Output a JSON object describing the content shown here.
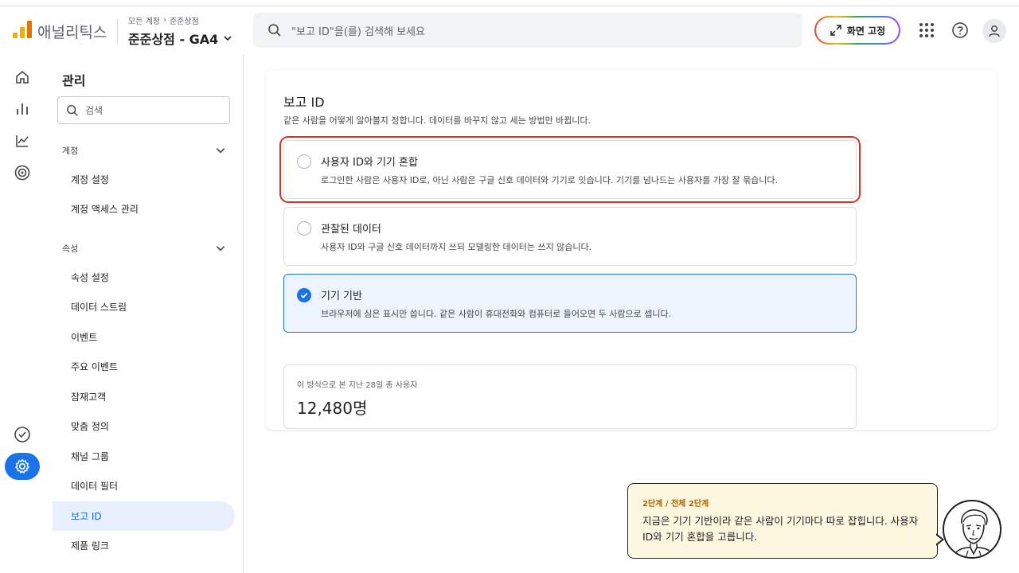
{
  "header": {
    "app_name": "애널리틱스",
    "breadcrumb_root": "모든 계정",
    "breadcrumb_sep": "›",
    "breadcrumb_account": "준준상점",
    "property_name": "준준상점 - GA4",
    "search_placeholder": "\"보고 ID\"을(를) 검색해 보세요",
    "pin_button": "화면 고정",
    "logo_colors": [
      "#f9ab00",
      "#f9ab00",
      "#e37400"
    ]
  },
  "rail": {
    "icons": [
      "home-icon",
      "reports-icon",
      "explore-icon",
      "advertising-icon",
      "check-circle-icon",
      "admin-gear-icon"
    ]
  },
  "sidenav": {
    "title": "관리",
    "search_placeholder": "검색",
    "section_account": "계정",
    "account_items": [
      "계정 설정",
      "계정 액세스 관리"
    ],
    "section_property": "속성",
    "property_items": [
      "속성 설정",
      "데이터 스트림",
      "이벤트",
      "주요 이벤트",
      "잠재고객",
      "맞춤 정의",
      "채널 그룹",
      "데이터 필터",
      "보고 ID",
      "제품 링크"
    ],
    "active_item": "보고 ID"
  },
  "card": {
    "title": "보고 ID",
    "description": "같은 사람을 어떻게 알아볼지 정합니다. 데이터를 바꾸지 않고 세는 방법만 바뀝니다.",
    "options": [
      {
        "title": "사용자 ID와 기기 혼합",
        "desc": "로그인한 사람은 사용자 ID로, 아닌 사람은 구글 신호 데이터와 기기로 잇습니다. 기기를 넘나드는 사용자를 가장 잘 묶습니다.",
        "selected": false,
        "highlighted": true
      },
      {
        "title": "관찰된 데이터",
        "desc": "사용자 ID와 구글 신호 데이터까지 쓰되 모델링한 데이터는 쓰지 않습니다.",
        "selected": false,
        "highlighted": false
      },
      {
        "title": "기기 기반",
        "desc": "브라우저에 심은 표시만 씁니다. 같은 사람이 휴대전화와 컴퓨터로 들어오면 두 사람으로 셉니다.",
        "selected": true,
        "highlighted": false
      }
    ],
    "stat_label": "이 방식으로 본 지난 28일 총 사용자",
    "stat_value": "12,480명"
  },
  "tooltip": {
    "step": "2단계 / 전체 2단계",
    "text": "지금은 기기 기반이라 같은 사람이 기기마다 따로 잡힙니다. 사용자 ID와 기기 혼합을 고릅니다."
  },
  "colors": {
    "accent": "#1a73e8",
    "highlight": "#d93025",
    "tooltip_bg": "#fef7e0"
  }
}
